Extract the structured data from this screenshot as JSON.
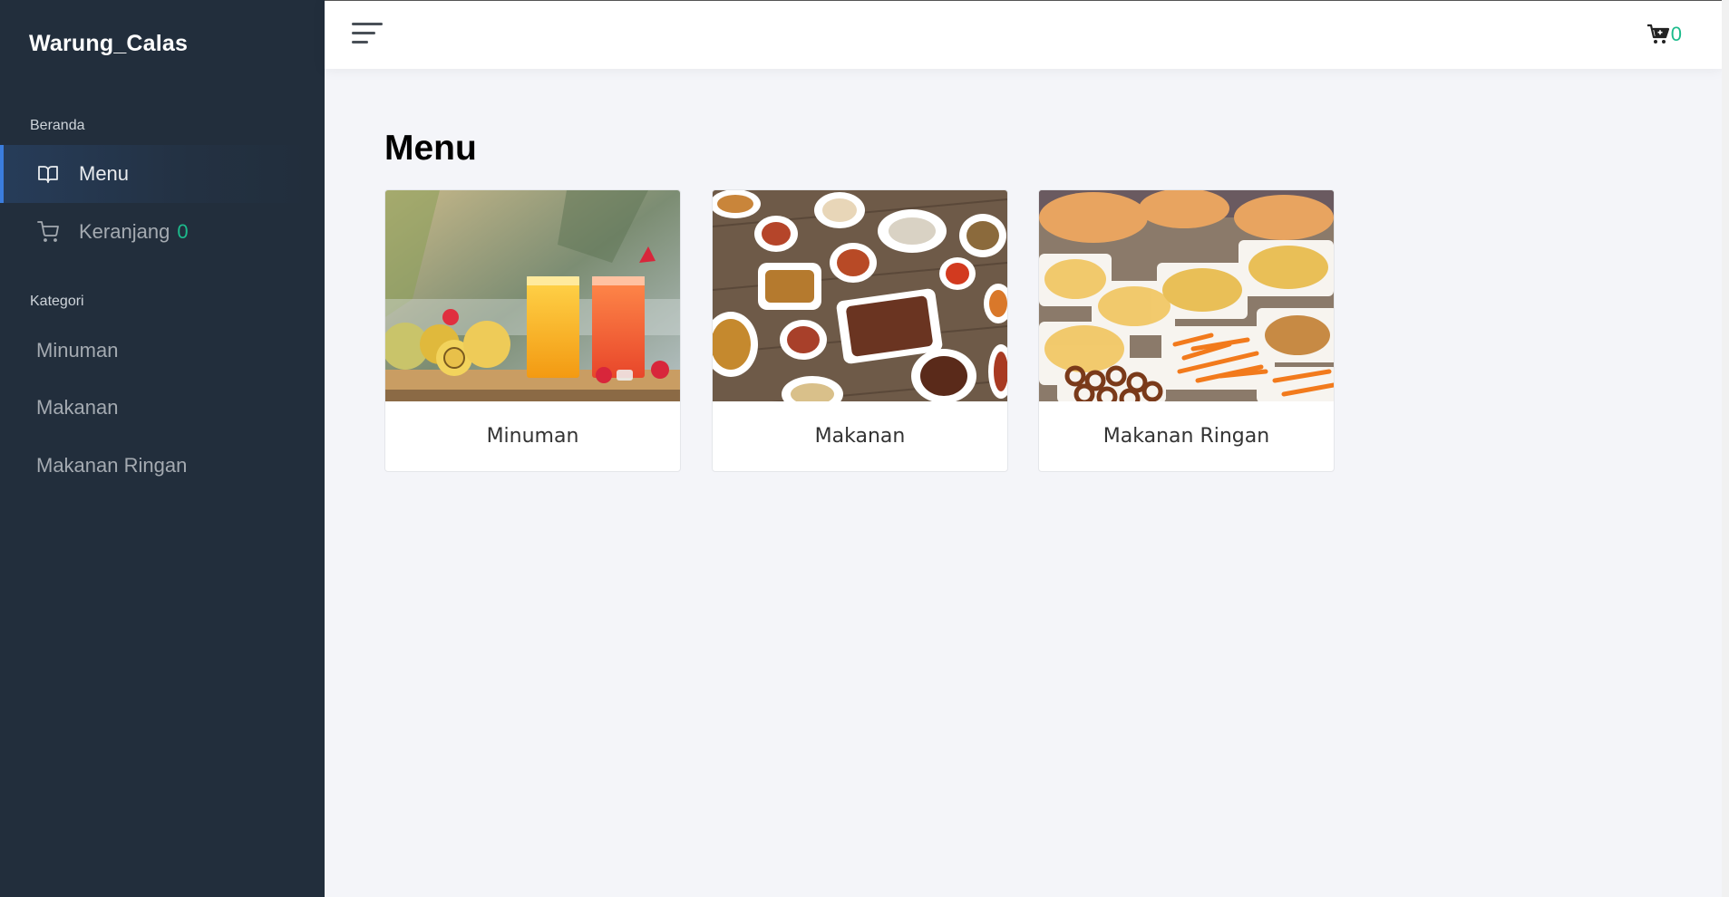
{
  "sidebar": {
    "brand": "Warung_Calas",
    "sections": [
      {
        "header": "Beranda"
      },
      {
        "header": "Kategori"
      }
    ],
    "nav": {
      "menu": {
        "label": "Menu",
        "icon": "book-open-icon",
        "active": true
      },
      "cart": {
        "label": "Keranjang",
        "count": "0",
        "icon": "shopping-cart-icon"
      }
    },
    "categories": [
      "Minuman",
      "Makanan",
      "Makanan Ringan"
    ]
  },
  "topbar": {
    "toggle_icon": "hamburger-icon",
    "cart_icon": "cart-plus-icon",
    "cart_count": "0"
  },
  "main": {
    "title": "Menu",
    "cards": [
      {
        "label": "Minuman",
        "image": "drinks-photo"
      },
      {
        "label": "Makanan",
        "image": "food-dishes-photo"
      },
      {
        "label": "Makanan Ringan",
        "image": "snacks-photo"
      }
    ]
  },
  "colors": {
    "sidebar_bg": "#222e3c",
    "accent": "#3b7ddd",
    "badge_green": "#1cbb8c",
    "page_bg": "#f4f5f9"
  }
}
